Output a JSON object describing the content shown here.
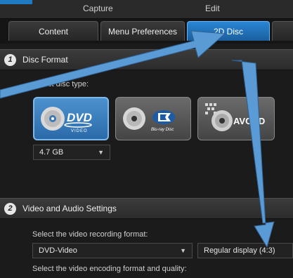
{
  "header": {
    "capture": "Capture",
    "edit": "Edit"
  },
  "tabs": [
    {
      "label": "Content"
    },
    {
      "label": "Menu Preferences"
    },
    {
      "label": "2D Disc"
    },
    {
      "label": ""
    }
  ],
  "disc_format": {
    "number": "1",
    "title": "Disc Format",
    "type_label": "Select disc type:",
    "discs": [
      {
        "name": "DVD",
        "sub": "VIDEO",
        "selected": true
      },
      {
        "name": "Blu-ray Disc",
        "selected": false
      },
      {
        "name": "AVCHD",
        "selected": false
      }
    ],
    "size": "4.7 GB"
  },
  "video_audio": {
    "number": "2",
    "title": "Video and Audio Settings",
    "record_label": "Select the video recording format:",
    "format": "DVD-Video",
    "display": "Regular display (4:3)",
    "encoding_label": "Select the video encoding format and quality:"
  },
  "colors": {
    "accent": "#2a86d4",
    "arrow": "#5b9bd5"
  }
}
